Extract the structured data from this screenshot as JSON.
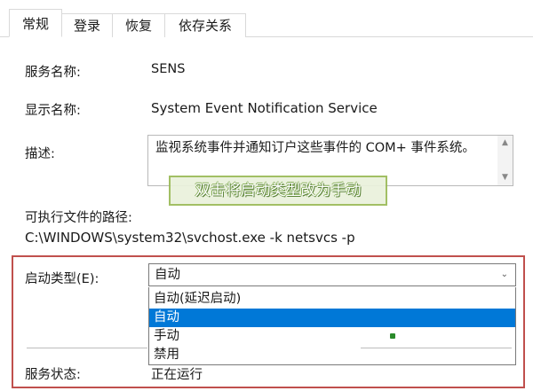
{
  "tabs": [
    {
      "label": "常规"
    },
    {
      "label": "登录"
    },
    {
      "label": "恢复"
    },
    {
      "label": "依存关系"
    }
  ],
  "fields": {
    "service_name": {
      "label": "服务名称:",
      "value": "SENS"
    },
    "display_name": {
      "label": "显示名称:",
      "value": "System Event Notification Service"
    },
    "description": {
      "label": "描述:",
      "value": "监视系统事件并通知订户这些事件的 COM+ 事件系统。"
    },
    "path": {
      "label": "可执行文件的路径:",
      "value": "C:\\WINDOWS\\system32\\svchost.exe -k netsvcs -p"
    },
    "startup_type": {
      "label": "启动类型(E):",
      "value": "自动"
    },
    "service_status": {
      "label": "服务状态:",
      "value": "正在运行"
    }
  },
  "startup_options": [
    "自动(延迟启动)",
    "自动",
    "手动",
    "禁用"
  ],
  "highlighted_option_index": 1,
  "annotation": {
    "note": "双击将启动类型改为手动"
  },
  "colors": {
    "highlight": "#0078d7",
    "note_border": "#9bbb59",
    "red_frame": "#c0504d"
  },
  "icons": {
    "scroll_up": "▲",
    "scroll_down": "▼",
    "dropdown_chevron": "⌄"
  }
}
